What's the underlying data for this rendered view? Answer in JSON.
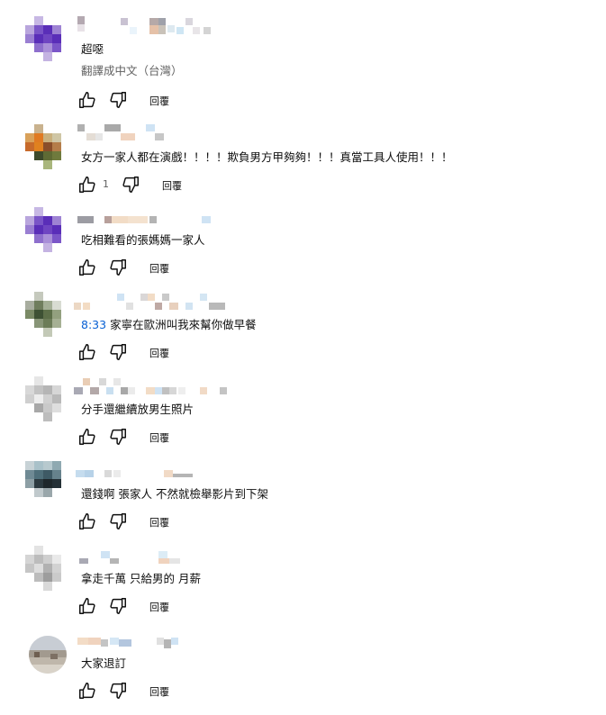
{
  "reply_label": "回覆",
  "colors": {
    "text": "#0f0f0f",
    "secondary": "#606060",
    "link": "#065fd4"
  },
  "comments": [
    {
      "text": "超噁",
      "translate_label": "翻譯成中文（台灣）",
      "like_count": ""
    },
    {
      "text": "女方一家人都在演戲！！！！欺負男方甲夠夠！！！真當工具人使用！！！",
      "like_count": "1"
    },
    {
      "text": "吃相難看的張媽媽一家人",
      "like_count": ""
    },
    {
      "timestamp": "8:33",
      "text": "家寧在歐洲叫我來幫你做早餐",
      "like_count": ""
    },
    {
      "text": "分手還繼續放男生照片",
      "like_count": ""
    },
    {
      "text": "還錢啊   張家人  不然就檢舉影片到下架",
      "like_count": ""
    },
    {
      "text": "拿走千萬 只給男的 月薪",
      "like_count": ""
    },
    {
      "text": "大家退訂",
      "like_count": ""
    }
  ],
  "icons": {
    "like": "thumb-up-icon",
    "dislike": "thumb-down-icon"
  }
}
